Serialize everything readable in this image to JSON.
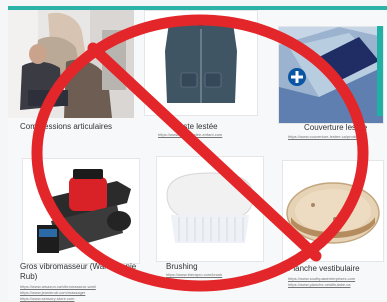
{
  "items": [
    {
      "caption": "Compressions articulaires"
    },
    {
      "caption": "Veste lestée",
      "source": "https://www.veste-lestee-enfant.com"
    },
    {
      "caption": "Couverture lestée",
      "source": "https://www.couverture-lestee.ca/produit"
    },
    {
      "caption": "Gros vibromasseur (Wahl/Jeanie Rub)",
      "sources": [
        "https://www.amazon.ca/vibromasseur-wahl",
        "https://www.jeanierub.com/massager",
        "https://www.sensory-store.com"
      ]
    },
    {
      "caption": "Brushing",
      "source": "https://www.therapro.com/brush"
    },
    {
      "caption": "Planche vestibulaire",
      "sources": [
        "https://www.southpawenterprises.com",
        "https://www.planche-vestibulaire.ca"
      ]
    }
  ],
  "icons": {
    "blanket_badge": "blue-cross-icon",
    "prohibition": "prohibition-sign-icon"
  },
  "colors": {
    "prohibition": "#e3262a",
    "accent": "#2bb3a8"
  }
}
